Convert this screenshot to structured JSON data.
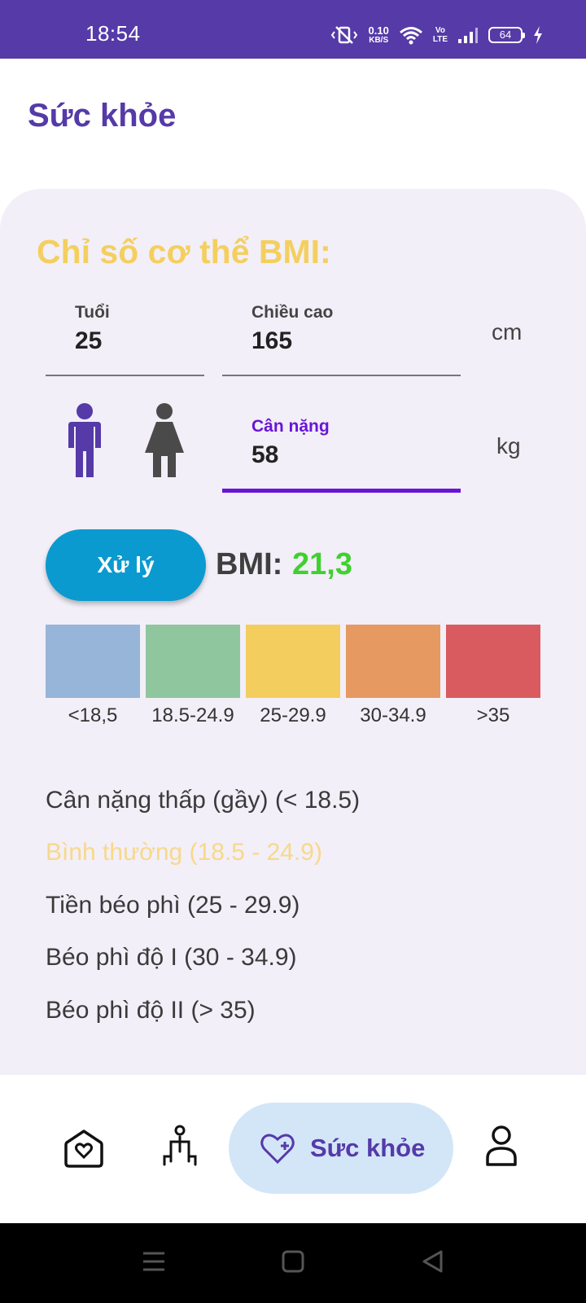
{
  "status_bar": {
    "time": "18:54",
    "net_speed_value": "0.10",
    "net_speed_unit": "KB/S",
    "volte_top": "Vo",
    "volte_bottom": "LTE",
    "battery": "64"
  },
  "header": {
    "title": "Sức khỏe"
  },
  "bmi_card": {
    "heading": "Chỉ số cơ thể BMI:",
    "age": {
      "label": "Tuổi",
      "value": "25"
    },
    "height": {
      "label": "Chiều cao",
      "value": "165",
      "unit": "cm"
    },
    "weight": {
      "label": "Cân nặng",
      "value": "58",
      "unit": "kg"
    },
    "process_button": "Xử lý",
    "result_label": "BMI:",
    "result_value": "21,3",
    "scale": [
      {
        "label": "<18,5",
        "color": "#97b5d9"
      },
      {
        "label": "18.5-24.9",
        "color": "#90c69e"
      },
      {
        "label": "25-29.9",
        "color": "#f4cd5f"
      },
      {
        "label": "30-34.9",
        "color": "#e79962"
      },
      {
        "label": ">35",
        "color": "#d95b5f"
      }
    ],
    "categories": [
      "Cân nặng thấp (gầy) (< 18.5)",
      "Bình thường (18.5 - 24.9)",
      "Tiền béo phì (25 - 29.9)",
      "Béo phì độ I (30 - 34.9)",
      "Béo phì độ II (> 35)"
    ],
    "highlighted_category_index": 1
  },
  "bottom_nav": {
    "items": [
      {
        "icon": "home-heart-icon"
      },
      {
        "icon": "exercise-icon"
      },
      {
        "icon": "heart-plus-icon",
        "label": "Sức khỏe",
        "active": true
      },
      {
        "icon": "profile-icon"
      }
    ]
  },
  "colors": {
    "primary": "#553aa8",
    "accent": "#6a14d8",
    "heading": "#f4cf5f",
    "bmi_value": "#3fd12e",
    "button": "#0a9ad0"
  }
}
